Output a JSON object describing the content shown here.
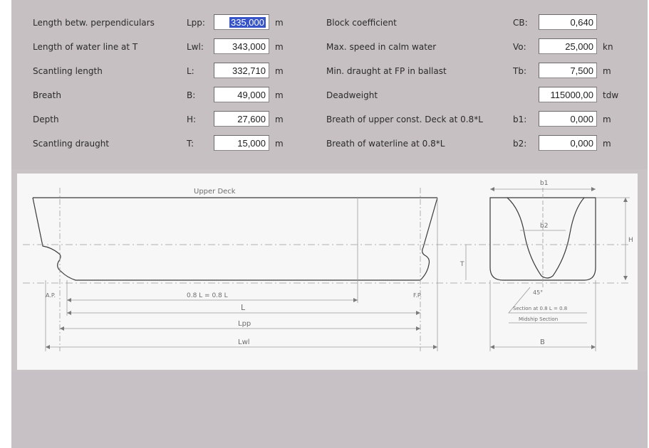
{
  "left_fields": [
    {
      "label": "Length betw. perpendiculars",
      "symbol": "Lpp:",
      "value": "335,000",
      "unit": "m",
      "selected": true
    },
    {
      "label": "Length of water line at T",
      "symbol": "Lwl:",
      "value": "343,000",
      "unit": "m"
    },
    {
      "label": "Scantling length",
      "symbol": "L:",
      "value": "332,710",
      "unit": "m"
    },
    {
      "label": "Breath",
      "symbol": "B:",
      "value": "49,000",
      "unit": "m"
    },
    {
      "label": "Depth",
      "symbol": "H:",
      "value": "27,600",
      "unit": "m"
    },
    {
      "label": "Scantling draught",
      "symbol": "T:",
      "value": "15,000",
      "unit": "m"
    }
  ],
  "right_fields": [
    {
      "label": "Block coefficient",
      "symbol": "CB:",
      "value": "0,640",
      "unit": ""
    },
    {
      "label": "Max. speed in calm water",
      "symbol": "Vo:",
      "value": "25,000",
      "unit": "kn"
    },
    {
      "label": "Min. draught at FP in ballast",
      "symbol": "Tb:",
      "value": "7,500",
      "unit": "m"
    },
    {
      "label": "Deadweight",
      "symbol": "",
      "value": "115000,00",
      "unit": "tdw"
    },
    {
      "label": "Breath of upper const. Deck at 0.8*L",
      "symbol": "b1:",
      "value": "0,000",
      "unit": "m"
    },
    {
      "label": "Breath of waterline at 0.8*L",
      "symbol": "b2:",
      "value": "0,000",
      "unit": "m"
    }
  ],
  "drawing": {
    "upper_deck_label": "Upper Deck",
    "dim_08L": "0.8 L = 0.8 L",
    "dim_L": "L",
    "dim_Lpp": "Lpp",
    "dim_Lwl": "Lwl",
    "ap": "A.P.",
    "fp": "F.P.",
    "section_b1": "b1",
    "section_b2": "b2",
    "section_T": "T",
    "section_H": "H",
    "section_B": "B",
    "section_angle": "45°",
    "section_note1": "Section at 0.8 L = 0.8",
    "section_note2": "Midship Section"
  },
  "colors": {
    "selection": "#3654c8",
    "panel": "#c6c0c3",
    "drawing_bg": "#f7f7f7"
  }
}
